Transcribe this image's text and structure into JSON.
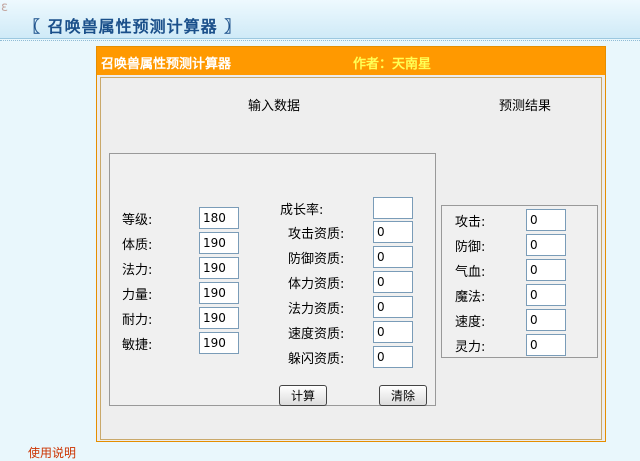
{
  "header": {
    "title": "〖 召唤兽属性预测计算器 〗"
  },
  "side_glyph": "ε",
  "calculator": {
    "title": "召唤兽属性预测计算器",
    "author": "作者：天南星",
    "input_section_title": "输入数据",
    "result_section_title": "预测结果",
    "base_fields": [
      {
        "label": "等级:",
        "value": "180"
      },
      {
        "label": "体质:",
        "value": "190"
      },
      {
        "label": "法力:",
        "value": "190"
      },
      {
        "label": "力量:",
        "value": "190"
      },
      {
        "label": "耐力:",
        "value": "190"
      },
      {
        "label": "敏捷:",
        "value": "190"
      }
    ],
    "growth_field": {
      "label": "成长率:",
      "value": ""
    },
    "aptitude_fields": [
      {
        "label": "攻击资质:",
        "value": "0"
      },
      {
        "label": "防御资质:",
        "value": "0"
      },
      {
        "label": "体力资质:",
        "value": "0"
      },
      {
        "label": "法力资质:",
        "value": "0"
      },
      {
        "label": "速度资质:",
        "value": "0"
      },
      {
        "label": "躲闪资质:",
        "value": "0"
      }
    ],
    "result_fields": [
      {
        "label": "攻击:",
        "value": "0"
      },
      {
        "label": "防御:",
        "value": "0"
      },
      {
        "label": "气血:",
        "value": "0"
      },
      {
        "label": "魔法:",
        "value": "0"
      },
      {
        "label": "速度:",
        "value": "0"
      },
      {
        "label": "灵力:",
        "value": "0"
      }
    ],
    "calculate_label": "计算",
    "clear_label": "清除"
  },
  "footer": {
    "usage_link": "使用说明"
  }
}
